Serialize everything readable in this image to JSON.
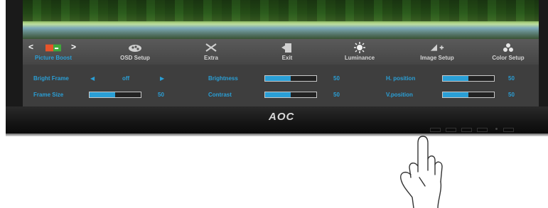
{
  "monitor": {
    "brand": "AOC"
  },
  "tabs": [
    {
      "label": "Picture Boost",
      "icon": "picture-boost-icon",
      "active": true
    },
    {
      "label": "OSD Setup",
      "icon": "osd-setup-icon"
    },
    {
      "label": "Extra",
      "icon": "extra-icon"
    },
    {
      "label": "Exit",
      "icon": "exit-icon"
    },
    {
      "label": "Luminance",
      "icon": "luminance-icon"
    },
    {
      "label": "Image Setup",
      "icon": "image-setup-icon"
    },
    {
      "label": "Color Setup",
      "icon": "color-setup-icon"
    }
  ],
  "settings": {
    "bright_frame": {
      "label": "Bright Frame",
      "value": "off"
    },
    "frame_size": {
      "label": "Frame Size",
      "value": "50",
      "level": 0.5
    },
    "brightness": {
      "label": "Brightness",
      "value": "50",
      "level": 0.5
    },
    "contrast": {
      "label": "Contrast",
      "value": "50",
      "level": 0.5
    },
    "h_position": {
      "label": "H. position",
      "value": "50",
      "level": 0.5
    },
    "v_position": {
      "label": "V.position",
      "value": "50",
      "level": 0.5
    }
  },
  "colors": {
    "accent": "#2a9fd6",
    "osd_bg": "#4a4a4a",
    "bezel": "#1a1a1a"
  }
}
